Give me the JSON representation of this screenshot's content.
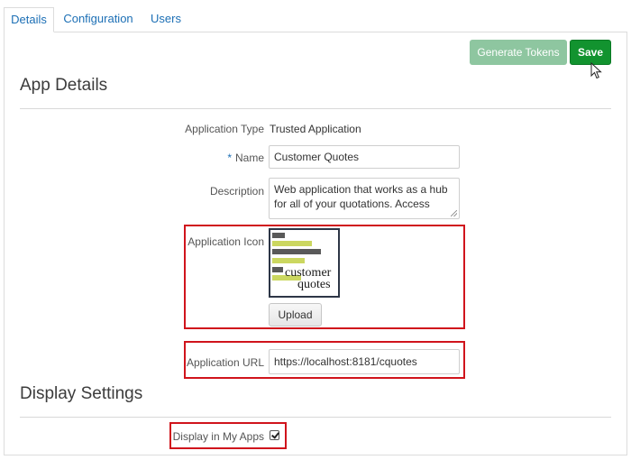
{
  "tabs": [
    {
      "label": "Details",
      "active": true
    },
    {
      "label": "Configuration",
      "active": false
    },
    {
      "label": "Users",
      "active": false
    }
  ],
  "toolbar": {
    "generate_tokens_label": "Generate Tokens",
    "save_label": "Save"
  },
  "app_details": {
    "title": "App Details",
    "application_type": {
      "label": "Application Type",
      "value": "Trusted Application"
    },
    "name": {
      "required_marker": "*",
      "label": "Name",
      "value": "Customer Quotes"
    },
    "description": {
      "label": "Description",
      "value": "Web application that works as a hub for all of your quotations. Access"
    },
    "application_icon": {
      "label": "Application Icon",
      "logo_line1": "customer",
      "logo_line2": "quotes",
      "upload_label": "Upload"
    },
    "application_url": {
      "label": "Application URL",
      "value": "https://localhost:8181/cquotes"
    }
  },
  "display_settings": {
    "title": "Display Settings",
    "display_in_my_apps": {
      "label": "Display in My Apps",
      "checked": true
    }
  },
  "colors": {
    "accent_link": "#1c6fb5",
    "save_green": "#12932f",
    "generate_tokens_green": "#8ec6a0",
    "highlight_red": "#d0141c",
    "logo_lime": "#cbd760",
    "logo_gray": "#595959"
  },
  "icons": {
    "pointer": "mouse-pointer-icon",
    "checkbox": "checkmark-icon",
    "textarea_resize": "resize-grip-icon"
  }
}
